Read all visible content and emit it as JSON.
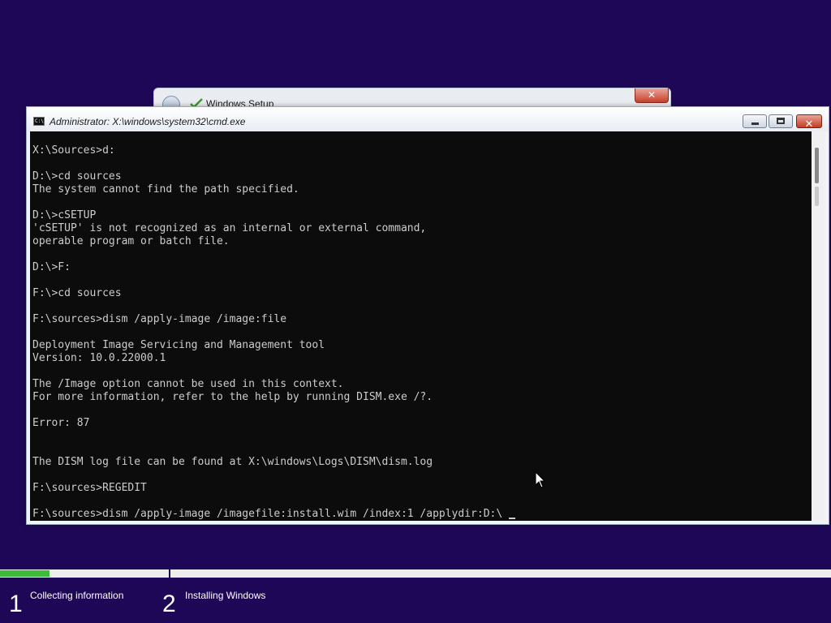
{
  "setup_window": {
    "title": "Windows Setup",
    "close_glyph": "✕"
  },
  "cmd_window": {
    "title": "Administrator: X:\\windows\\system32\\cmd.exe",
    "icon_text": "C:\\",
    "close_glyph": "✕",
    "console_lines": [
      "X:\\Sources>d:",
      "",
      "D:\\>cd sources",
      "The system cannot find the path specified.",
      "",
      "D:\\>cSETUP",
      "'cSETUP' is not recognized as an internal or external command,",
      "operable program or batch file.",
      "",
      "D:\\>F:",
      "",
      "F:\\>cd sources",
      "",
      "F:\\sources>dism /apply-image /image:file",
      "",
      "Deployment Image Servicing and Management tool",
      "Version: 10.0.22000.1",
      "",
      "The /Image option cannot be used in this context.",
      "For more information, refer to the help by running DISM.exe /?.",
      "",
      "Error: 87",
      "",
      "",
      "The DISM log file can be found at X:\\windows\\Logs\\DISM\\dism.log",
      "",
      "F:\\sources>REGEDIT",
      "",
      "F:\\sources>dism /apply-image /imagefile:install.wim /index:1 /applydir:D:\\ "
    ]
  },
  "progress": {
    "fraction": 0.06
  },
  "steps": [
    {
      "number": "1",
      "label": "Collecting information"
    },
    {
      "number": "2",
      "label": "Installing Windows"
    }
  ],
  "colors": {
    "background": "#1e0757",
    "progress_fill": "#3fb93a",
    "console_bg": "#0c0c0c",
    "console_text": "#cccccc"
  },
  "icons": {
    "setup_back": "back-arrow-icon",
    "setup_logo": "windows-setup-logo-icon",
    "cmd": "command-prompt-icon",
    "pointer": "mouse-pointer-icon"
  }
}
